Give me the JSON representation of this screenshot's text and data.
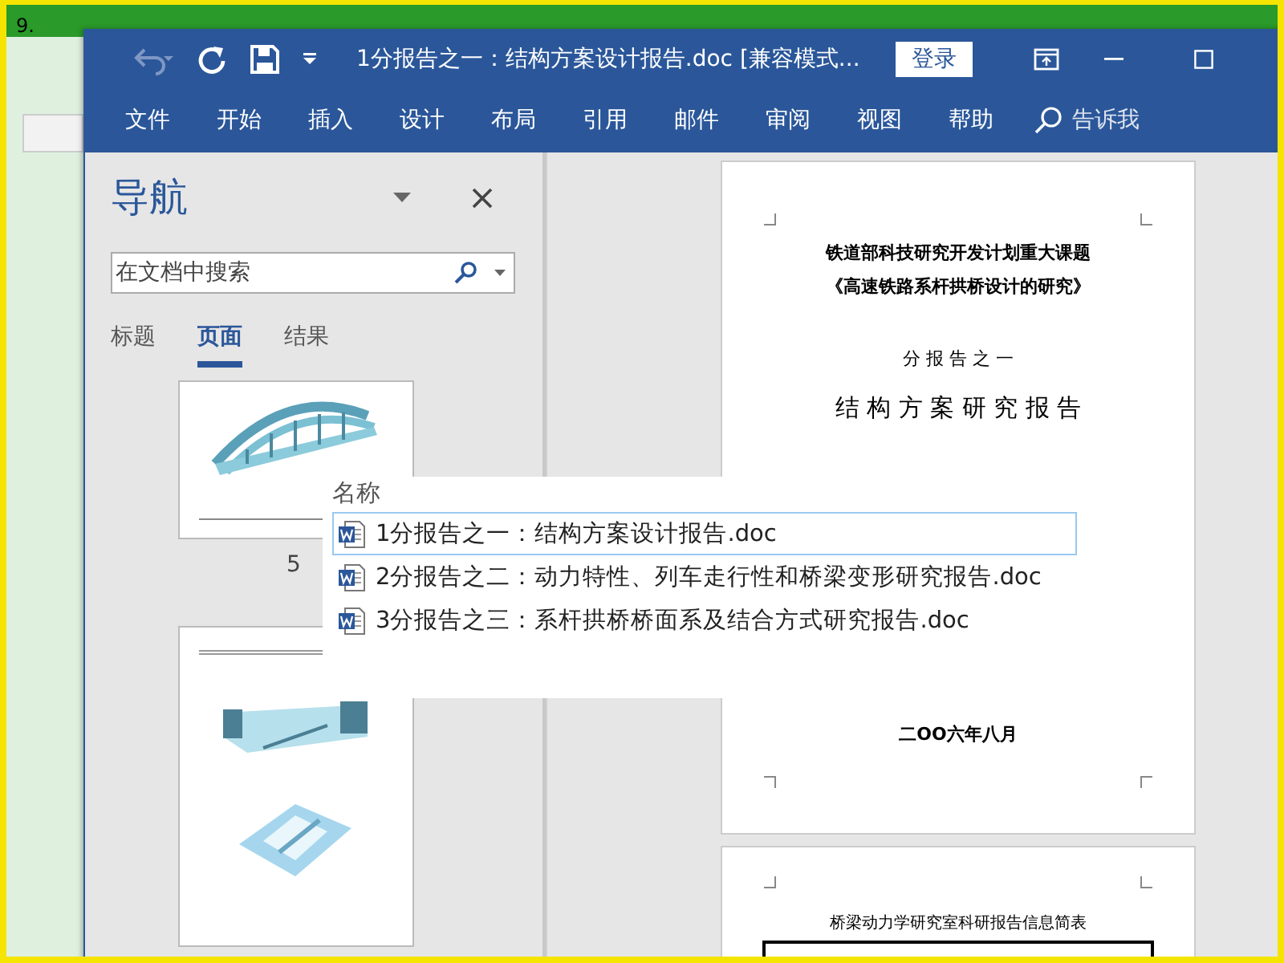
{
  "background": {
    "label": "9."
  },
  "window": {
    "title": "1分报告之一：结构方案设计报告.doc [兼容模式...",
    "login_button": "登录"
  },
  "ribbon": {
    "tabs": [
      {
        "label": "文件"
      },
      {
        "label": "开始"
      },
      {
        "label": "插入"
      },
      {
        "label": "设计"
      },
      {
        "label": "布局"
      },
      {
        "label": "引用"
      },
      {
        "label": "邮件"
      },
      {
        "label": "审阅"
      },
      {
        "label": "视图"
      },
      {
        "label": "帮助"
      }
    ],
    "tell_me": "告诉我"
  },
  "navigation": {
    "title": "导航",
    "search": {
      "placeholder": "在文档中搜索"
    },
    "tabs": [
      {
        "label": "标题",
        "selected": false
      },
      {
        "label": "页面",
        "selected": true
      },
      {
        "label": "结果",
        "selected": false
      }
    ],
    "page_label": "5"
  },
  "document": {
    "page_1": {
      "lines": [
        {
          "kind": "heading",
          "text": "铁道部科技研究开发计划重大课题"
        },
        {
          "kind": "heading",
          "text": "《高速铁路系杆拱桥设计的研究》"
        },
        {
          "kind": "subtitle",
          "text": "分 报 告 之 一"
        },
        {
          "kind": "title",
          "text": "结 构 方 案 研 究 报 告"
        },
        {
          "kind": "date",
          "text": "二OO六年八月"
        }
      ]
    },
    "page_2": {
      "table_title": "桥梁动力学研究室科研报告信息简表"
    }
  },
  "file_list": {
    "header": "名称",
    "files": [
      {
        "name": "1分报告之一：结构方案设计报告.doc",
        "selected": true
      },
      {
        "name": "2分报告之二：动力特性、列车走行性和桥梁变形研究报告.doc",
        "selected": false
      },
      {
        "name": "3分报告之三：系杆拱桥桥面系及结合方式研究报告.doc",
        "selected": false
      }
    ]
  }
}
